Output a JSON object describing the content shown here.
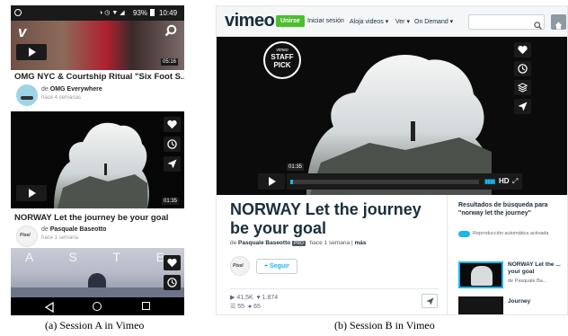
{
  "session_a": {
    "status": {
      "battery": "93%",
      "time": "10:49"
    },
    "top_video": {
      "duration": "05:16"
    },
    "video1": {
      "title": "OMG NYC & Courtship Ritual \"Six Foot S...",
      "by_prefix": "de",
      "author": "OMG Everywhere",
      "age": "hace 4 semanas"
    },
    "video2": {
      "duration": "01:35",
      "title": "NORWAY Let the journey be your goal",
      "by_prefix": "de",
      "author": "Pasquale Baseotto",
      "age": "hace 1 semana",
      "avatar_text": "Pixel"
    },
    "video3": {
      "letters": "A S T E"
    },
    "caption": "(a) Session A in Vimeo"
  },
  "session_b": {
    "logo": "vimeo",
    "nav": {
      "join": "Unirse",
      "login": "Iniciar sesión",
      "upload": "Aloja videos ▾",
      "watch": "Ver ▾",
      "on_demand": "On Demand ▾"
    },
    "search": {
      "placeholder": ""
    },
    "badge": {
      "top": "vimeo",
      "line1": "STAFF",
      "line2": "PICK"
    },
    "player": {
      "time_tooltip": "01:35",
      "hd": "HD"
    },
    "video": {
      "title": "NORWAY Let the journey be your goal",
      "by_prefix": "de",
      "author": "Pasquale Baseotto",
      "pro": "PRO",
      "age": "hace 1 semana",
      "more": "más",
      "follow": "+ Seguir",
      "avatar_text": "Pixel",
      "plays": "41,5K",
      "likes": "1.874",
      "collections": "55",
      "comments": "65"
    },
    "sidebar": {
      "heading": "Resultados de búsqueda para \"norway let the journey\"",
      "autoplay": "Reproducción automática activada",
      "items": [
        {
          "title": "NORWAY Let the ... your goal",
          "author": "de Pasquale Ba..."
        },
        {
          "title": "Journey",
          "author": ""
        }
      ]
    },
    "caption": "(b) Session B in Vimeo"
  }
}
